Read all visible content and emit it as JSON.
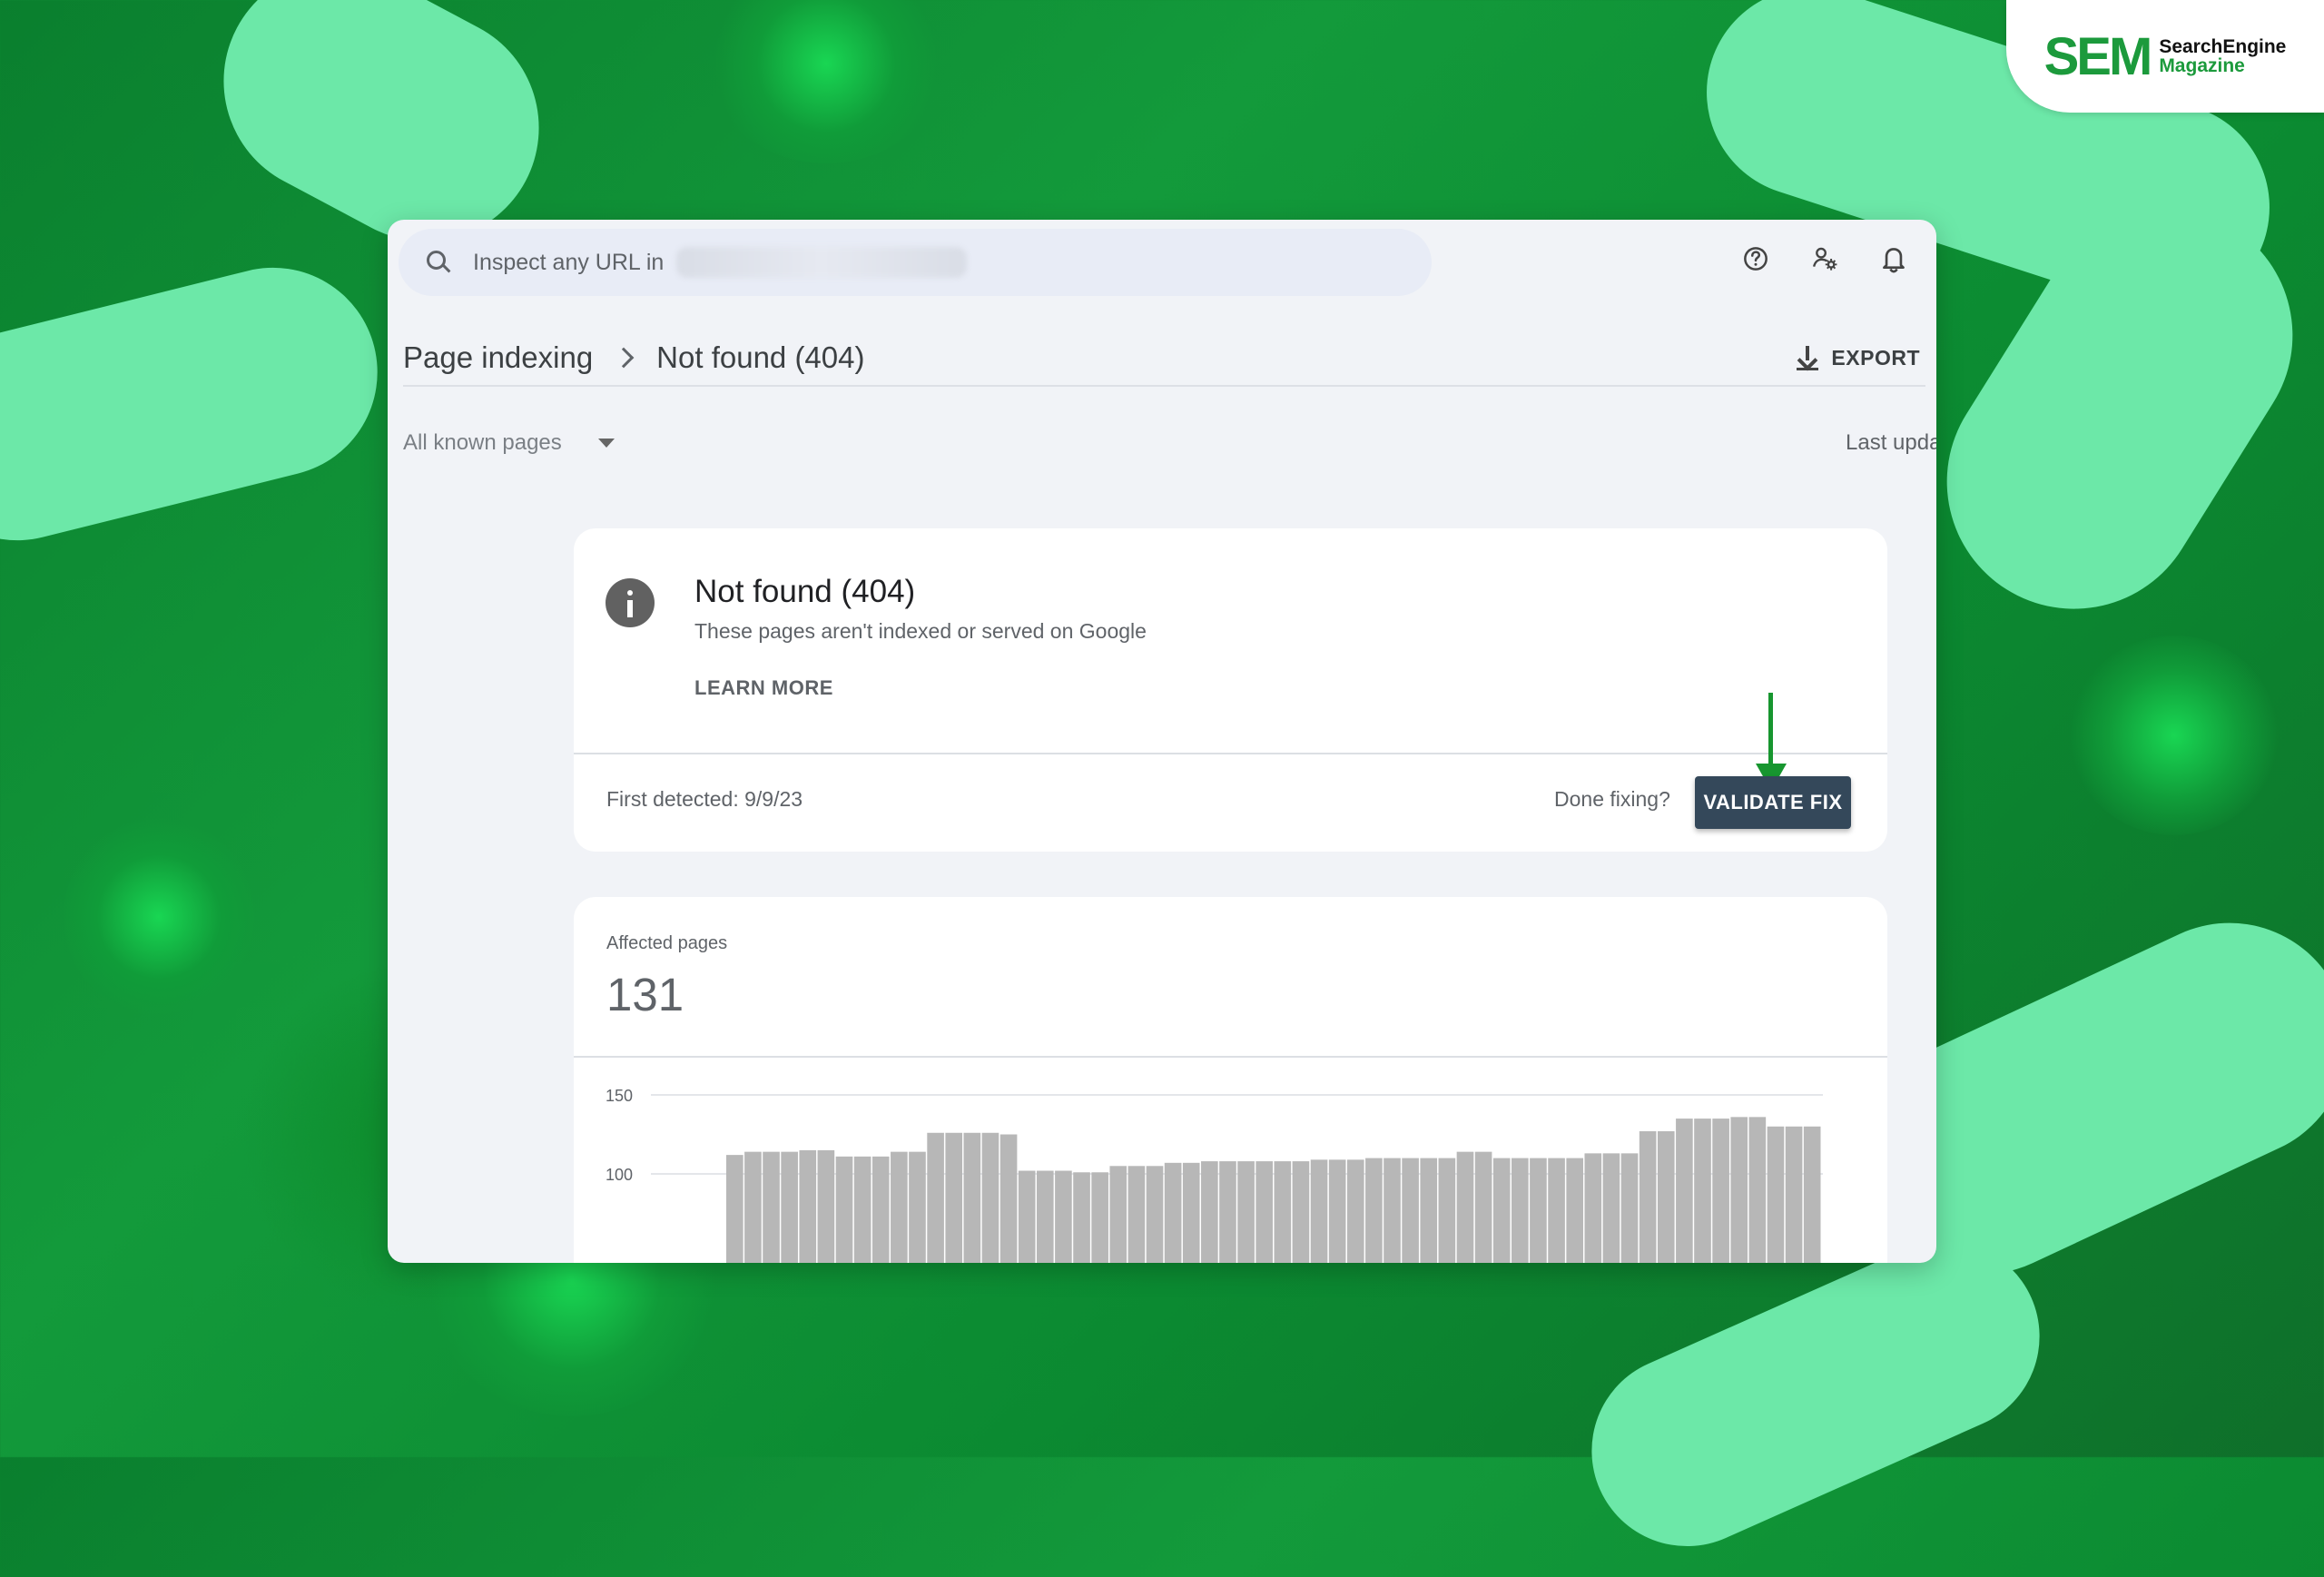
{
  "branding": {
    "logo_mark": "SE",
    "logo_mark_accent": "M",
    "logo_text": [
      "SearchEngine",
      "Magazine"
    ]
  },
  "search": {
    "placeholder": "Inspect any URL in"
  },
  "header_icons": [
    "help-icon",
    "manage-users-icon",
    "notifications-icon"
  ],
  "breadcrumb": {
    "parent": "Page indexing",
    "current": "Not found (404)"
  },
  "export": {
    "label": "EXPORT",
    "icon": "download-icon"
  },
  "filter": {
    "selected": "All known pages",
    "last_updated": "Last upda"
  },
  "issue": {
    "title": "Not found (404)",
    "description": "These pages aren't indexed or served on Google",
    "learn_more": "LEARN MORE",
    "first_detected": "First detected: 9/9/23",
    "done_fixing": "Done fixing?",
    "validate_button": "VALIDATE FIX",
    "annotation_arrow_color": "#17962f"
  },
  "affected": {
    "label": "Affected pages",
    "value": "131"
  },
  "chart_data": {
    "type": "bar",
    "title": "",
    "xlabel": "",
    "ylabel": "",
    "yticks": [
      150,
      100
    ],
    "ylim": [
      50,
      150
    ],
    "values": [
      112,
      114,
      114,
      114,
      115,
      115,
      111,
      111,
      111,
      114,
      114,
      126,
      126,
      126,
      126,
      125,
      102,
      102,
      102,
      101,
      101,
      105,
      105,
      105,
      107,
      107,
      108,
      108,
      108,
      108,
      108,
      108,
      109,
      109,
      109,
      110,
      110,
      110,
      110,
      110,
      114,
      114,
      110,
      110,
      110,
      110,
      110,
      113,
      113,
      113,
      127,
      127,
      135,
      135,
      135,
      136,
      136,
      130,
      130,
      130
    ],
    "bar_color": "#b7b7b7"
  }
}
